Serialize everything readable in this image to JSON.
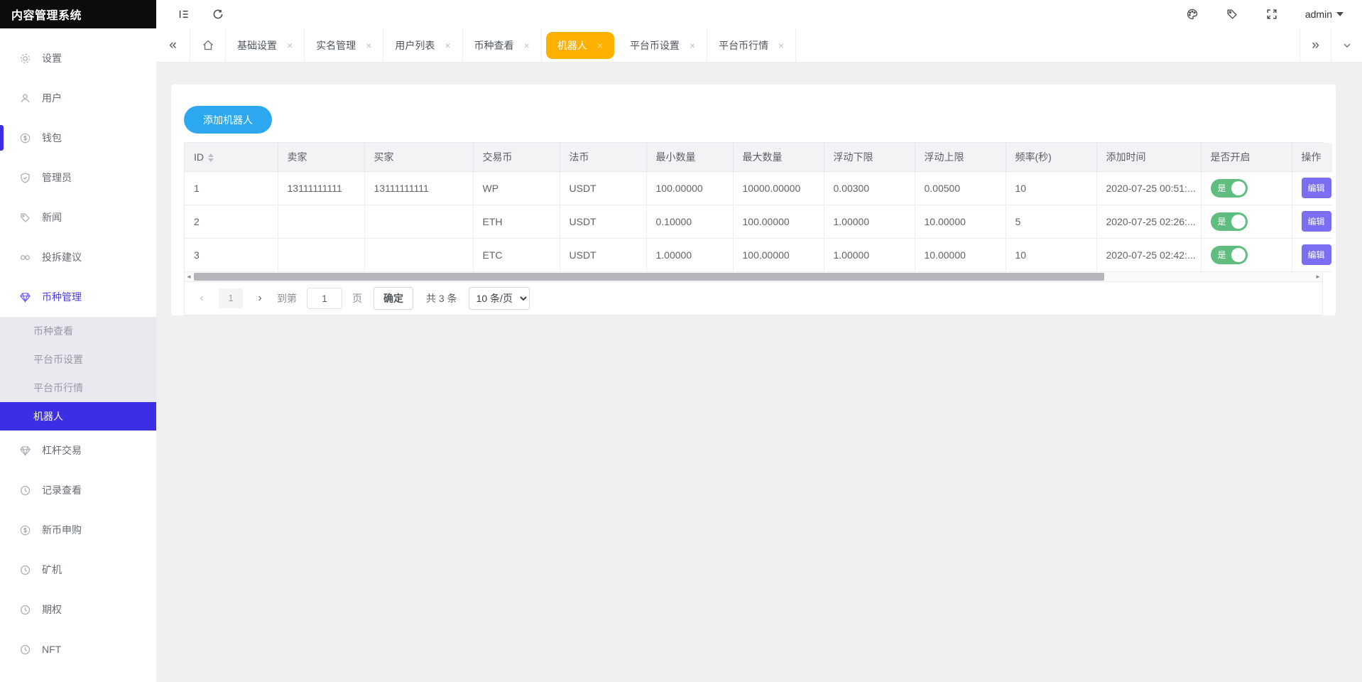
{
  "app": {
    "title": "内容管理系统",
    "user": "admin"
  },
  "colors": {
    "accent_purple": "#3b2ee4",
    "active_tab_orange": "#ffb000",
    "add_button_blue": "#2da8f0",
    "edit_button_purple": "#7a6ef2",
    "toggle_green": "#5fbe7f"
  },
  "tabbar": {
    "back": "«",
    "forward": "»",
    "close": "×",
    "tabs": [
      {
        "label": "基础设置"
      },
      {
        "label": "实名管理"
      },
      {
        "label": "用户列表"
      },
      {
        "label": "币种查看"
      },
      {
        "label": "机器人",
        "active": true
      },
      {
        "label": "平台币设置"
      },
      {
        "label": "平台币行情"
      }
    ]
  },
  "sidebar": {
    "items_top": [
      {
        "label": "设置"
      },
      {
        "label": "用户"
      },
      {
        "label": "钱包"
      },
      {
        "label": "管理员"
      },
      {
        "label": "新闻"
      },
      {
        "label": "投拆建议"
      },
      {
        "label": "币种管理"
      }
    ],
    "submenu": [
      {
        "label": "币种查看"
      },
      {
        "label": "平台币设置"
      },
      {
        "label": "平台币行情"
      },
      {
        "label": "机器人",
        "active": true
      }
    ],
    "items_bottom": [
      {
        "label": "杠杆交易"
      },
      {
        "label": "记录查看"
      },
      {
        "label": "新币申购"
      },
      {
        "label": "矿机"
      },
      {
        "label": "期权"
      },
      {
        "label": "NFT"
      }
    ]
  },
  "main": {
    "add_button": "添加机器人",
    "table": {
      "columns": [
        "ID",
        "卖家",
        "买家",
        "交易币",
        "法币",
        "最小数量",
        "最大数量",
        "浮动下限",
        "浮动上限",
        "频率(秒)",
        "添加时间",
        "是否开启",
        "操作"
      ],
      "rows": [
        {
          "cells": [
            "1",
            "13111111111",
            "13111111111",
            "WP",
            "USDT",
            "100.00000",
            "10000.00000",
            "0.00300",
            "0.00500",
            "10",
            "2020-07-25 00:51:..."
          ],
          "enabled_label": "是",
          "action": "编辑"
        },
        {
          "cells": [
            "2",
            "",
            "",
            "ETH",
            "USDT",
            "0.10000",
            "100.00000",
            "1.00000",
            "10.00000",
            "5",
            "2020-07-25 02:26:..."
          ],
          "enabled_label": "是",
          "action": "编辑"
        },
        {
          "cells": [
            "3",
            "",
            "",
            "ETC",
            "USDT",
            "1.00000",
            "100.00000",
            "1.00000",
            "10.00000",
            "10",
            "2020-07-25 02:42:..."
          ],
          "enabled_label": "是",
          "action": "编辑"
        }
      ]
    },
    "pagination": {
      "prev": "‹",
      "next": "›",
      "page": "1",
      "goto_label": "到第",
      "goto_value": "1",
      "page_label": "页",
      "confirm": "确定",
      "total": "共 3 条",
      "page_size": "10 条/页"
    }
  }
}
